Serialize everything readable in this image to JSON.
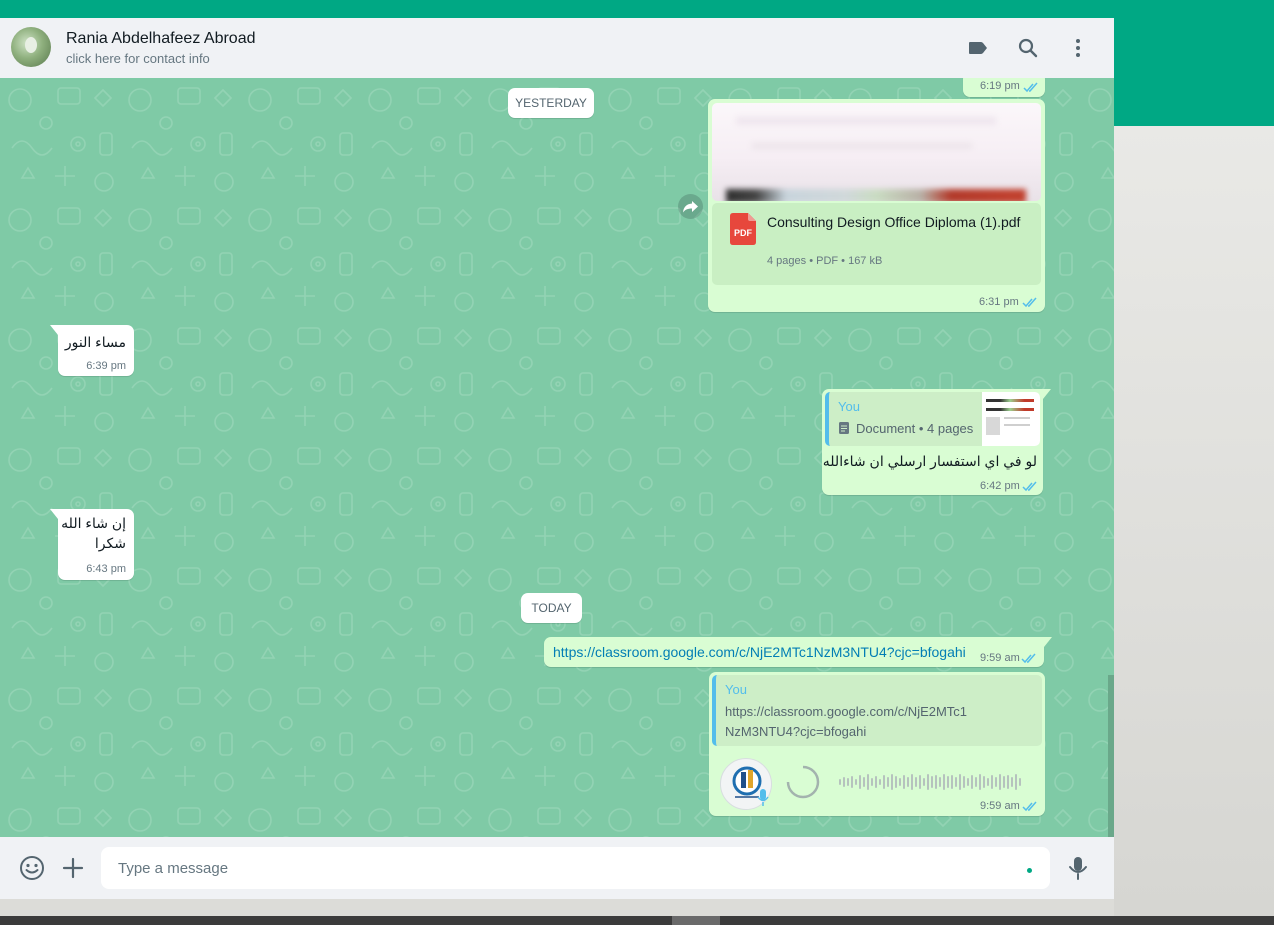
{
  "header": {
    "contact_name": "Rania Abdelhafeez Abroad",
    "contact_subtitle": "click here for contact info"
  },
  "chat": {
    "top_partial_time": "6:19 pm",
    "date_yesterday": "YESTERDAY",
    "date_today": "TODAY",
    "doc_message": {
      "file_name": "Consulting Design Office Diploma (1).pdf",
      "file_icon_label": "PDF",
      "file_meta": "4 pages • PDF • 167 kB",
      "time": "6:31 pm"
    },
    "incoming_1": {
      "text": "مساء النور",
      "time": "6:39 pm"
    },
    "reply_message": {
      "quoted_author": "You",
      "quoted_text": "Document • 4 pages",
      "text": "لو في اي استفسار ارسلي ان شاءالله",
      "time": "6:42 pm"
    },
    "incoming_2": {
      "line1": "إن شاء الله",
      "line2": "شكرا",
      "time": "6:43 pm"
    },
    "link_message": {
      "text": "https://classroom.google.com/c/NjE2MTc1NzM3NTU4?cjc=bfogahi",
      "time": "9:59 am"
    },
    "voice_message": {
      "quoted_author": "You",
      "quoted_line1": "https://classroom.google.com/c/NjE2MTc1",
      "quoted_line2": "NzM3NTU4?cjc=bfogahi",
      "time": "9:59 am"
    }
  },
  "composer": {
    "placeholder": "Type a message"
  },
  "colors": {
    "accent": "#00a884",
    "chat_background": "#7fcaa6",
    "outgoing_bubble": "#d9fdd3",
    "incoming_bubble": "#ffffff",
    "read_ticks": "#53bdeb",
    "pdf_icon": "#e7473c"
  },
  "icons": [
    "label-icon",
    "search-icon",
    "menu-icon",
    "forward-icon",
    "pdf-icon",
    "document-icon",
    "emoji-icon",
    "plus-icon",
    "microphone-icon",
    "double-check-icon"
  ]
}
